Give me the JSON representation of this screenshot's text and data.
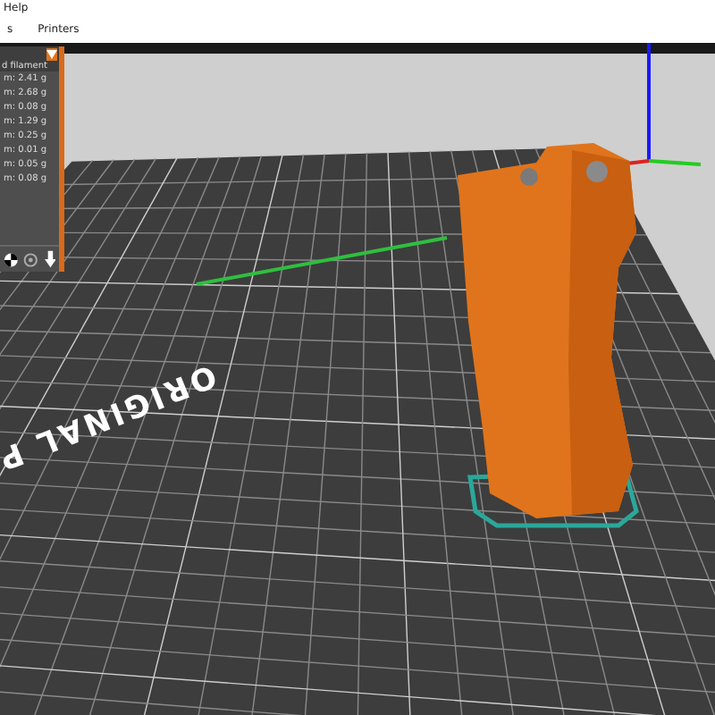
{
  "menu": {
    "items": [
      "Help"
    ]
  },
  "tabs": [
    {
      "label": "s",
      "selected": false
    },
    {
      "label": "Printers",
      "selected": false
    }
  ],
  "filament_panel": {
    "header": "d filament",
    "rows": [
      "m: 2.41 g",
      "m: 2.68 g",
      "m: 0.08 g",
      "m: 1.29 g",
      "m: 0.25 g",
      "m: 0.01 g",
      "m: 0.05 g",
      "m: 0.08 g"
    ]
  },
  "bed_label": "ORIGINAL P"
}
